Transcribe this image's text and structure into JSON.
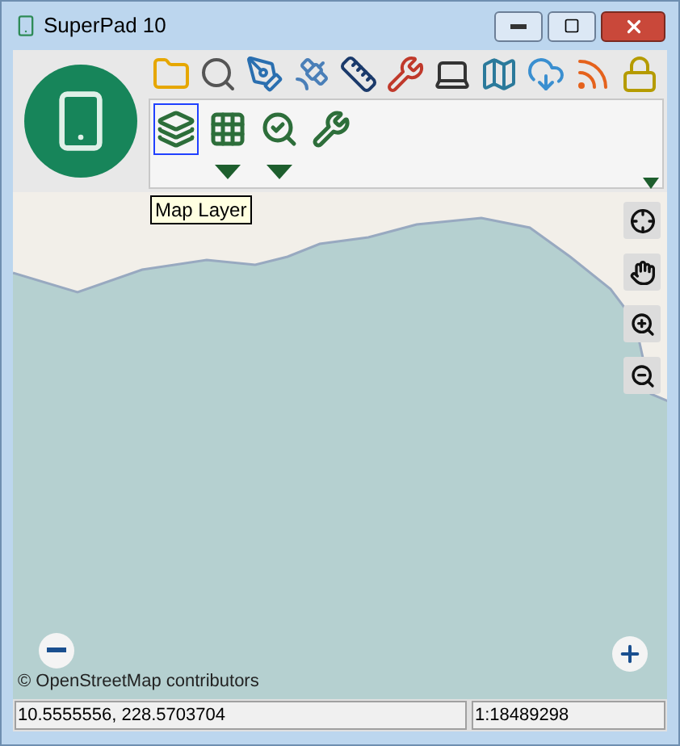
{
  "window": {
    "title": "SuperPad 10"
  },
  "ribbon": {
    "items": [
      {
        "selected": true,
        "dropdown": false
      },
      {
        "selected": false,
        "dropdown": true
      },
      {
        "selected": false,
        "dropdown": true
      },
      {
        "selected": false,
        "dropdown": false
      }
    ],
    "overflow": true
  },
  "tooltip": "Map Layer",
  "map": {
    "attribution": "© OpenStreetMap contributors"
  },
  "status_bar": {
    "coordinates": "10.5555556, 228.5703704",
    "scale": "1:18489298"
  }
}
